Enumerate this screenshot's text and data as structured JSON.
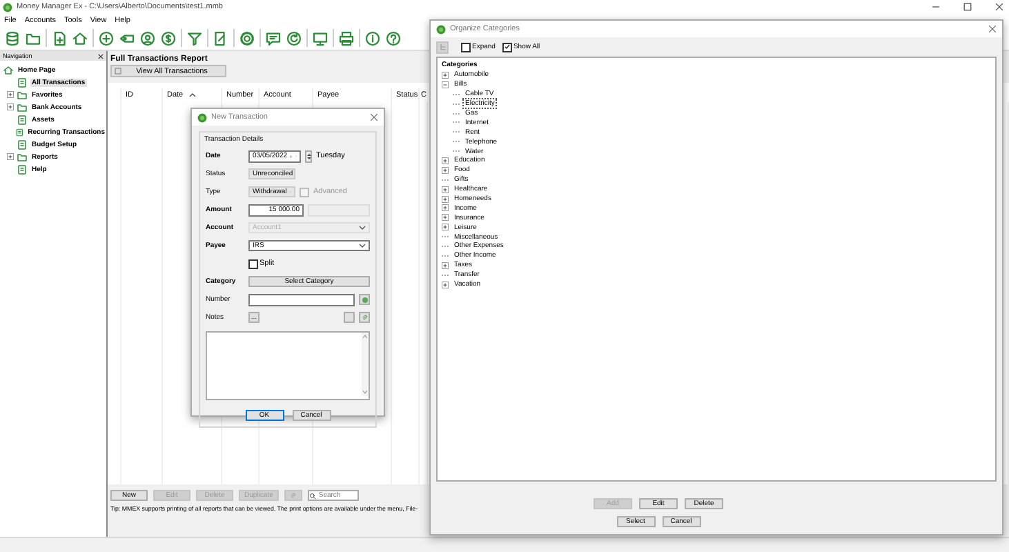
{
  "window": {
    "title": "Money Manager Ex - C:\\Users\\Alberto\\Documents\\test1.mmb"
  },
  "menu": [
    "File",
    "Accounts",
    "Tools",
    "View",
    "Help"
  ],
  "navigation": {
    "title": "Navigation",
    "items": [
      {
        "label": "Home Page",
        "kind": "home",
        "selected": false,
        "children": [
          {
            "label": "All Transactions",
            "kind": "item",
            "selected": true
          },
          {
            "label": "Favorites",
            "kind": "group",
            "expanded": false,
            "selected": false
          },
          {
            "label": "Bank Accounts",
            "kind": "group",
            "expanded": false,
            "selected": false
          },
          {
            "label": "Assets",
            "kind": "item",
            "selected": false
          },
          {
            "label": "Recurring Transactions",
            "kind": "item",
            "selected": false
          },
          {
            "label": "Budget Setup",
            "kind": "item",
            "selected": false
          },
          {
            "label": "Reports",
            "kind": "group",
            "expanded": false,
            "selected": false
          },
          {
            "label": "Help",
            "kind": "item",
            "selected": false
          }
        ]
      }
    ]
  },
  "report": {
    "title": "Full Transactions Report",
    "view_button": "View All Transactions",
    "columns": [
      {
        "label": "ID"
      },
      {
        "label": "Date",
        "sorted": true
      },
      {
        "label": "Number"
      },
      {
        "label": "Account"
      },
      {
        "label": "Payee"
      },
      {
        "label": "Status"
      },
      {
        "label": "C"
      }
    ]
  },
  "actions": [
    {
      "label": "New",
      "disabled": false
    },
    {
      "label": "Edit",
      "disabled": true
    },
    {
      "label": "Delete",
      "disabled": true
    },
    {
      "label": "Duplicate",
      "disabled": true
    }
  ],
  "search": {
    "placeholder": "Search"
  },
  "tip": "Tip: MMEX supports printing of all reports that can be viewed. The print options are available under the menu, File-",
  "new_transaction": {
    "title": "New Transaction",
    "group": "Transaction Details",
    "date": {
      "label": "Date",
      "bold": true,
      "value": "03/05/2022",
      "weekday": "Tuesday"
    },
    "status": {
      "label": "Status",
      "bold": false,
      "value": "Unreconciled"
    },
    "type": {
      "label": "Type",
      "bold": false,
      "value": "Withdrawal",
      "advanced": {
        "label": "Advanced",
        "checked": false,
        "disabled": true
      }
    },
    "amount": {
      "label": "Amount",
      "bold": true,
      "value": "15 000.00"
    },
    "account": {
      "label": "Account",
      "bold": true,
      "value": "Account1",
      "disabled": true
    },
    "payee": {
      "label": "Payee",
      "bold": true,
      "value": "IRS"
    },
    "split": {
      "label": "Split",
      "checked": false
    },
    "category": {
      "label": "Category",
      "bold": true,
      "button": "Select Category"
    },
    "number": {
      "label": "Number",
      "bold": false
    },
    "notes": {
      "label": "Notes",
      "bold": false,
      "button": "..."
    },
    "buttons": [
      {
        "label": "OK",
        "default": true
      },
      {
        "label": "Cancel",
        "default": false
      }
    ]
  },
  "categories_dialog": {
    "title": "Organize Categories",
    "expand": {
      "label": "Expand",
      "checked": false
    },
    "show_all": {
      "label": "Show All",
      "checked": true
    },
    "header": "Categories",
    "items": [
      {
        "label": "Automobile",
        "expanded": false,
        "selected": false
      },
      {
        "label": "Bills",
        "expanded": true,
        "selected": false,
        "children": [
          {
            "label": "Cable TV",
            "selected": false
          },
          {
            "label": "Electricity",
            "selected": true
          },
          {
            "label": "Gas",
            "selected": false
          },
          {
            "label": "Internet",
            "selected": false
          },
          {
            "label": "Rent",
            "selected": false
          },
          {
            "label": "Telephone",
            "selected": false
          },
          {
            "label": "Water",
            "selected": false
          }
        ]
      },
      {
        "label": "Education",
        "expanded": false,
        "selected": false
      },
      {
        "label": "Food",
        "expanded": false,
        "selected": false
      },
      {
        "label": "Gifts",
        "selected": false
      },
      {
        "label": "Healthcare",
        "expanded": false,
        "selected": false
      },
      {
        "label": "Homeneeds",
        "expanded": false,
        "selected": false
      },
      {
        "label": "Income",
        "expanded": false,
        "selected": false
      },
      {
        "label": "Insurance",
        "expanded": false,
        "selected": false
      },
      {
        "label": "Leisure",
        "expanded": false,
        "selected": false
      },
      {
        "label": "Miscellaneous",
        "selected": false
      },
      {
        "label": "Other Expenses",
        "selected": false
      },
      {
        "label": "Other Income",
        "selected": false
      },
      {
        "label": "Taxes",
        "expanded": false,
        "selected": false
      },
      {
        "label": "Transfer",
        "selected": false
      },
      {
        "label": "Vacation",
        "expanded": false,
        "selected": false
      }
    ],
    "buttons": [
      {
        "label": "Add",
        "disabled": true
      },
      {
        "label": "Edit",
        "disabled": false
      },
      {
        "label": "Delete",
        "disabled": false
      }
    ],
    "footer_buttons": [
      "Select",
      "Cancel"
    ]
  }
}
